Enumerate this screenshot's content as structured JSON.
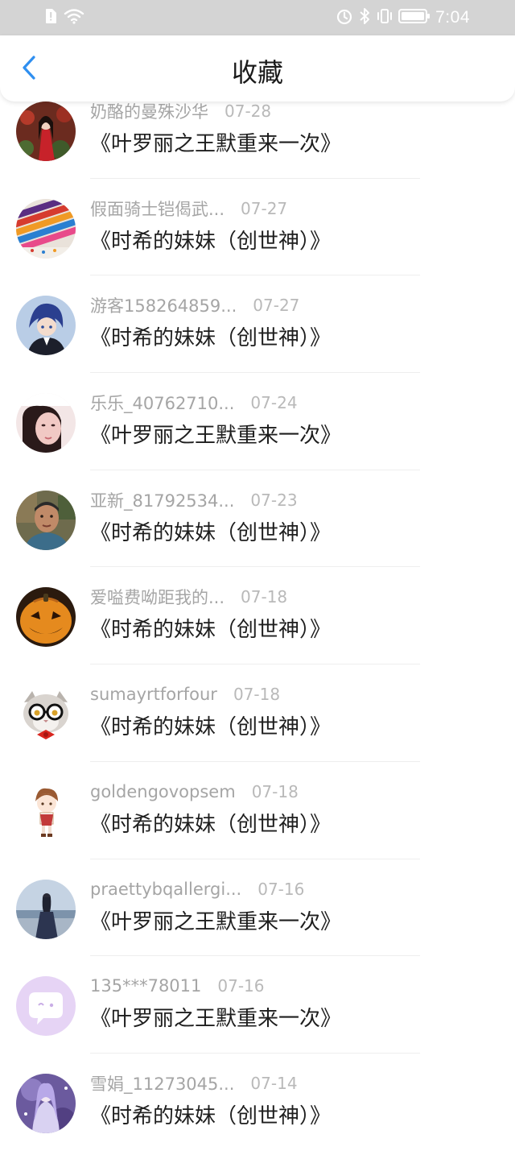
{
  "status_bar": {
    "time": "7:04",
    "left_icons": [
      "sim-alert-icon",
      "wifi-icon"
    ],
    "right_icons": [
      "alarm-icon",
      "bluetooth-icon",
      "vibrate-icon",
      "battery-icon"
    ]
  },
  "header": {
    "title": "收藏",
    "back_icon": "chevron-left-icon",
    "accent_color": "#2f8ff0"
  },
  "favorites": [
    {
      "user": "奶酪的曼殊沙华",
      "date": "07-28",
      "book": "《叶罗丽之王默重来一次》",
      "avatar": "avatar-red-robed-figure"
    },
    {
      "user": "假面骑士铠偈武...",
      "date": "07-27",
      "book": "《时希的妹妹（创世神）》",
      "avatar": "avatar-crayons"
    },
    {
      "user": "游客158264859...",
      "date": "07-27",
      "book": "《时希的妹妹（创世神）》",
      "avatar": "avatar-anime-blue-hair"
    },
    {
      "user": "乐乐_40762710...",
      "date": "07-24",
      "book": "《叶罗丽之王默重来一次》",
      "avatar": "avatar-girl-selfie"
    },
    {
      "user": "亚新_81792534...",
      "date": "07-23",
      "book": "《时希的妹妹（创世神）》",
      "avatar": "avatar-man-photo"
    },
    {
      "user": "爱嗌费呦距我的...",
      "date": "07-18",
      "book": "《时希的妹妹（创世神）》",
      "avatar": "avatar-jack-o-lantern"
    },
    {
      "user": "sumayrtforfour",
      "date": "07-18",
      "book": "《时希的妹妹（创世神）》",
      "avatar": "avatar-cat-glasses"
    },
    {
      "user": "goldengovopsem",
      "date": "07-18",
      "book": "《时希的妹妹（创世神）》",
      "avatar": "avatar-chibi-boy"
    },
    {
      "user": "praettybqallergi...",
      "date": "07-16",
      "book": "《叶罗丽之王默重来一次》",
      "avatar": "avatar-girl-seaside"
    },
    {
      "user": "135***78011",
      "date": "07-16",
      "book": "《叶罗丽之王默重来一次》",
      "avatar": "avatar-default-chat"
    },
    {
      "user": "雪娟_11273045...",
      "date": "07-14",
      "book": "《时希的妹妹（创世神）》",
      "avatar": "avatar-purple-fantasy"
    }
  ]
}
